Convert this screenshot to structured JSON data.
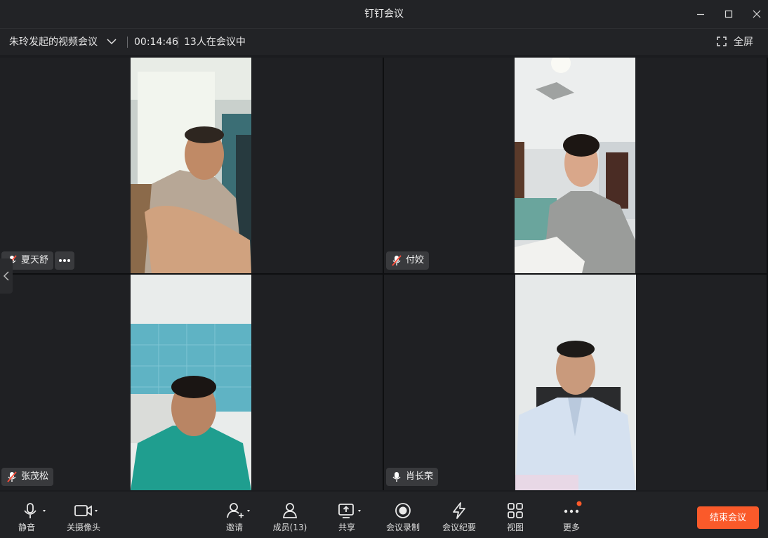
{
  "window": {
    "title": "钉钉会议"
  },
  "meeting": {
    "name": "朱玲发起的视频会议",
    "duration": "00:14:46",
    "participants_status": "13人在会议中",
    "fullscreen_label": "全屏"
  },
  "participants": [
    {
      "name": "夏天舒",
      "muted": true
    },
    {
      "name": "付姣",
      "muted": true
    },
    {
      "name": "张茂松",
      "muted": true
    },
    {
      "name": "肖长荣",
      "muted": false
    }
  ],
  "toolbar": {
    "mute_label": "静音",
    "camera_label": "关摄像头",
    "invite_label": "邀请",
    "members_label": "成员(13)",
    "share_label": "共享",
    "record_label": "会议录制",
    "minutes_label": "会议纪要",
    "view_label": "视图",
    "more_label": "更多",
    "end_label": "结束会议"
  },
  "colors": {
    "accent": "#fa5a2a",
    "notification_dot": "#ff5a2a",
    "background": "#1b1c1f"
  }
}
